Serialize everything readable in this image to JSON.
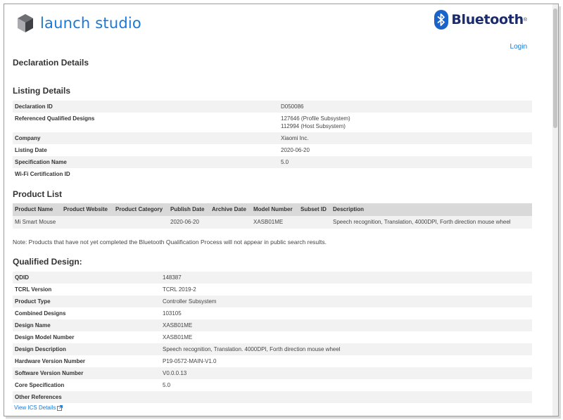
{
  "header": {
    "brand": "launch studio",
    "partner_logo": "Bluetooth",
    "login": "Login"
  },
  "page_title": "Declaration Details",
  "listing": {
    "title": "Listing Details",
    "rows": [
      {
        "label": "Declaration ID",
        "value": "D050086",
        "value2": ""
      },
      {
        "label": "Referenced Qualified Designs",
        "value": "127646 (Profile Subsystem)",
        "value2": "112994 (Host Subsystem)"
      },
      {
        "label": "Company",
        "value": "Xiaomi Inc.",
        "value2": ""
      },
      {
        "label": "Listing Date",
        "value": "2020-06-20",
        "value2": ""
      },
      {
        "label": "Specification Name",
        "value": "5.0",
        "value2": ""
      },
      {
        "label": "Wi-Fi Certification ID",
        "value": "",
        "value2": ""
      }
    ]
  },
  "product_list": {
    "title": "Product List",
    "columns": [
      "Product Name",
      "Product Website",
      "Product Category",
      "Publish Date",
      "Archive Date",
      "Model Number",
      "Subset ID",
      "Description"
    ],
    "rows": [
      [
        "Mi Smart Mouse",
        "",
        "",
        "2020-06-20",
        "",
        "XASB01ME",
        "",
        "Speech recognition, Translation, 4000DPI, Forth direction mouse wheel"
      ]
    ]
  },
  "note": "Note: Products that have not yet completed the Bluetooth Qualification Process will not appear in public search results.",
  "qualified_design": {
    "title": "Qualified Design:",
    "rows": [
      {
        "label": "QDID",
        "value": "148387"
      },
      {
        "label": "TCRL Version",
        "value": "TCRL 2019-2"
      },
      {
        "label": "Product Type",
        "value": "Controller Subsystem"
      },
      {
        "label": "Combined Designs",
        "value": "103105"
      },
      {
        "label": "Design Name",
        "value": "XASB01ME"
      },
      {
        "label": "Design Model Number",
        "value": "XASB01ME"
      },
      {
        "label": "Design Description",
        "value": "Speech recognition, Translation. 4000DPI, Forth direction mouse wheel"
      },
      {
        "label": "Hardware Version Number",
        "value": "P19-0572-MAIN-V1.0"
      },
      {
        "label": "Software Version Number",
        "value": "V0.0.0.13"
      },
      {
        "label": "Core Specification",
        "value": "5.0"
      },
      {
        "label": "Other References",
        "value": ""
      }
    ],
    "ics_link": "View ICS Details"
  },
  "colors": {
    "link": "#1a78d6",
    "row_alt": "#f2f2f2",
    "header_bg": "#d9d9d9",
    "bluetooth_blue": "#1a63c9"
  }
}
